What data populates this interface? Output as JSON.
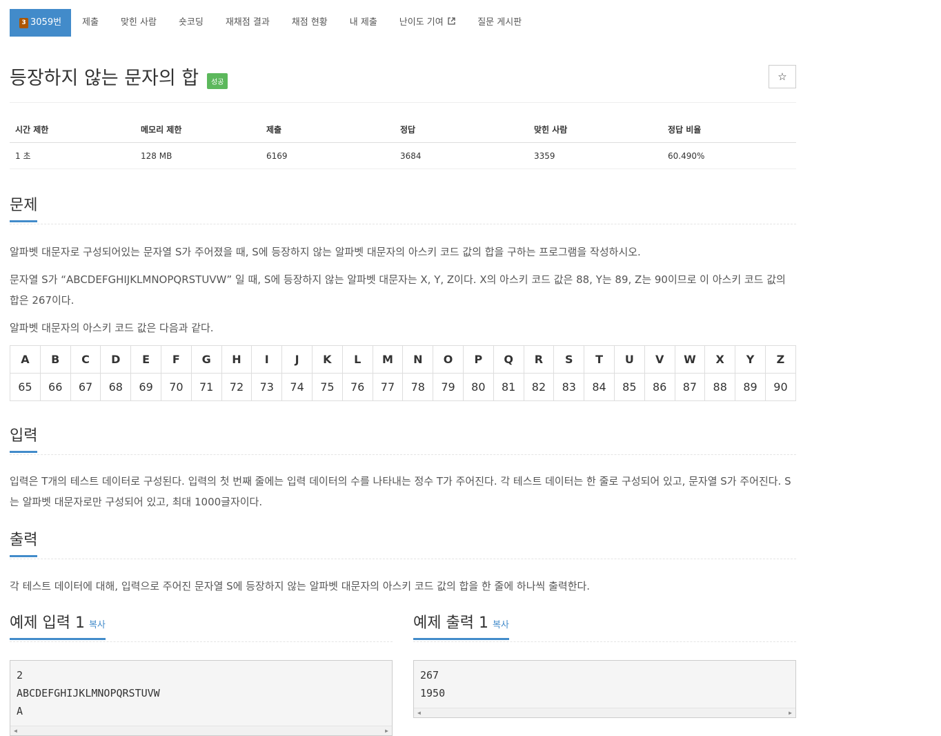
{
  "tabs": [
    {
      "tier": "3",
      "label": "3059번"
    },
    {
      "label": "제출"
    },
    {
      "label": "맞힌 사람"
    },
    {
      "label": "숏코딩"
    },
    {
      "label": "재채점 결과"
    },
    {
      "label": "채점 현황"
    },
    {
      "label": "내 제출"
    },
    {
      "label": "난이도 기여"
    },
    {
      "label": "질문 게시판"
    }
  ],
  "title": "등장하지 않는 문자의 합",
  "badge": "성공",
  "star": "☆",
  "info": {
    "headers": [
      "시간 제한",
      "메모리 제한",
      "제출",
      "정답",
      "맞힌 사람",
      "정답 비율"
    ],
    "values": [
      "1 초",
      "128 MB",
      "6169",
      "3684",
      "3359",
      "60.490%"
    ]
  },
  "problem": {
    "heading": "문제",
    "p1": "알파벳 대문자로 구성되어있는 문자열 S가 주어졌을 때, S에 등장하지 않는 알파벳 대문자의 아스키 코드 값의 합을 구하는 프로그램을 작성하시오.",
    "p2": "문자열 S가 “ABCDEFGHIJKLMNOPQRSTUVW” 일 때, S에 등장하지 않는 알파벳 대문자는 X, Y, Z이다. X의 아스키 코드 값은 88, Y는 89, Z는 90이므로 이 아스키 코드 값의 합은 267이다.",
    "p3": "알파벳 대문자의 아스키 코드 값은 다음과 같다.",
    "letters": [
      "A",
      "B",
      "C",
      "D",
      "E",
      "F",
      "G",
      "H",
      "I",
      "J",
      "K",
      "L",
      "M",
      "N",
      "O",
      "P",
      "Q",
      "R",
      "S",
      "T",
      "U",
      "V",
      "W",
      "X",
      "Y",
      "Z"
    ],
    "codes": [
      "65",
      "66",
      "67",
      "68",
      "69",
      "70",
      "71",
      "72",
      "73",
      "74",
      "75",
      "76",
      "77",
      "78",
      "79",
      "80",
      "81",
      "82",
      "83",
      "84",
      "85",
      "86",
      "87",
      "88",
      "89",
      "90"
    ]
  },
  "input": {
    "heading": "입력",
    "p": "입력은 T개의 테스트 데이터로 구성된다. 입력의 첫 번째 줄에는 입력 데이터의 수를 나타내는 정수 T가 주어진다. 각 테스트 데이터는 한 줄로 구성되어 있고, 문자열 S가 주어진다. S는 알파벳 대문자로만 구성되어 있고, 최대 1000글자이다."
  },
  "output": {
    "heading": "출력",
    "p": "각 테스트 데이터에 대해, 입력으로 주어진 문자열 S에 등장하지 않는 알파벳 대문자의 아스키 코드 값의 합을 한 줄에 하나씩 출력한다."
  },
  "sample_input": {
    "heading": "예제 입력 1",
    "copy": "복사",
    "text": "2\nABCDEFGHIJKLMNOPQRSTUVW\nA"
  },
  "sample_output": {
    "heading": "예제 출력 1",
    "copy": "복사",
    "text": "267\n1950"
  }
}
